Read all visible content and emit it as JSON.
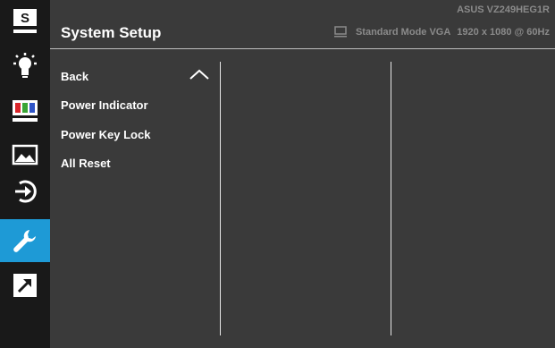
{
  "header": {
    "model": "ASUS  VZ249HEG1R",
    "title": "System Setup",
    "mode": "Standard Mode VGA",
    "resolution": "1920 x 1080 @ 60Hz",
    "status_icon": "monitor-icon"
  },
  "sidebar": {
    "items": [
      {
        "name": "splendid",
        "icon": "s-box-icon",
        "active": false
      },
      {
        "name": "blue-light-filter",
        "icon": "bulb-icon",
        "active": false
      },
      {
        "name": "color",
        "icon": "color-bars-icon",
        "active": false
      },
      {
        "name": "image",
        "icon": "mountain-image-icon",
        "active": false
      },
      {
        "name": "input-select",
        "icon": "input-arrow-icon",
        "active": false
      },
      {
        "name": "system-setup",
        "icon": "wrench-icon",
        "active": true
      },
      {
        "name": "shortcut",
        "icon": "shortcut-arrow-icon",
        "active": false
      }
    ],
    "s_label": "S"
  },
  "menu": {
    "items": [
      {
        "label": "Back"
      },
      {
        "label": "Power Indicator"
      },
      {
        "label": "Power Key Lock"
      },
      {
        "label": "All Reset"
      }
    ],
    "back_icon": "chevron-up-icon"
  },
  "colors": {
    "background": "#3a3a3a",
    "sidebar": "#191919",
    "active": "#1e9ad6",
    "header_text": "#8a8a8a",
    "divider": "#e6e6e6"
  }
}
